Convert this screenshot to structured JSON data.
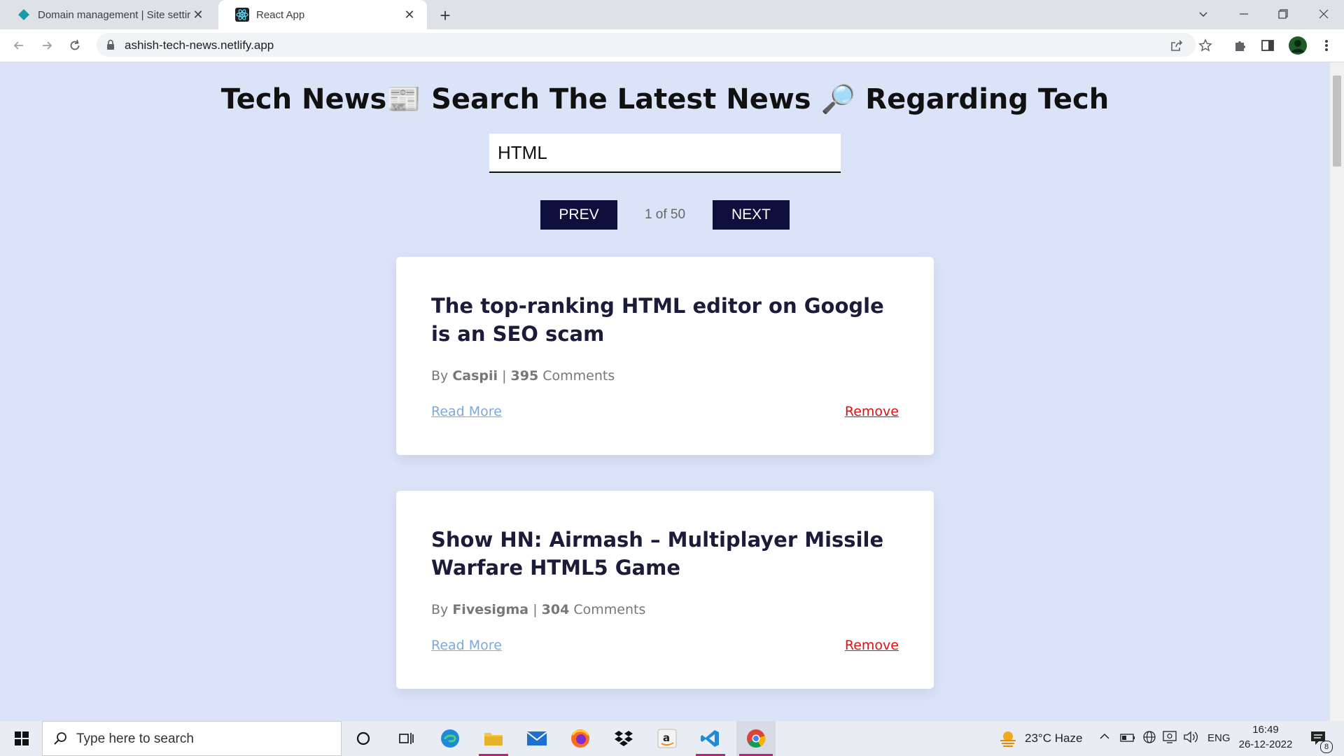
{
  "browser": {
    "tabs": [
      {
        "title": "Domain management | Site settir",
        "icon": "netlify-diamond-icon"
      },
      {
        "title": "React App",
        "icon": "react-logo-icon"
      }
    ],
    "url": "ashish-tech-news.netlify.app"
  },
  "page": {
    "heading": "Tech News📰 Search The Latest News 🔎 Regarding Tech",
    "search_value": "HTML",
    "pagination": {
      "prev_label": "PREV",
      "next_label": "NEXT",
      "info": "1 of 50"
    },
    "articles": [
      {
        "title": "The top-ranking HTML editor on Google is an SEO scam",
        "by": "By",
        "author": "Caspii",
        "sep": "|",
        "comments": "395",
        "comments_label": "Comments",
        "read_more": "Read More",
        "remove": "Remove"
      },
      {
        "title": "Show HN: Airmash – Multiplayer Missile Warfare HTML5 Game",
        "by": "By",
        "author": "Fivesigma",
        "sep": "|",
        "comments": "304",
        "comments_label": "Comments",
        "read_more": "Read More",
        "remove": "Remove"
      }
    ]
  },
  "taskbar": {
    "search_placeholder": "Type here to search",
    "weather": "23°C  Haze",
    "language": "ENG",
    "time": "16:49",
    "date": "26-12-2022",
    "notification_count": "8"
  },
  "colors": {
    "page_bg": "#dbe3f8",
    "button_bg": "#0f0f3d",
    "remove": "#e01010",
    "read_more": "#7fa7e0"
  }
}
